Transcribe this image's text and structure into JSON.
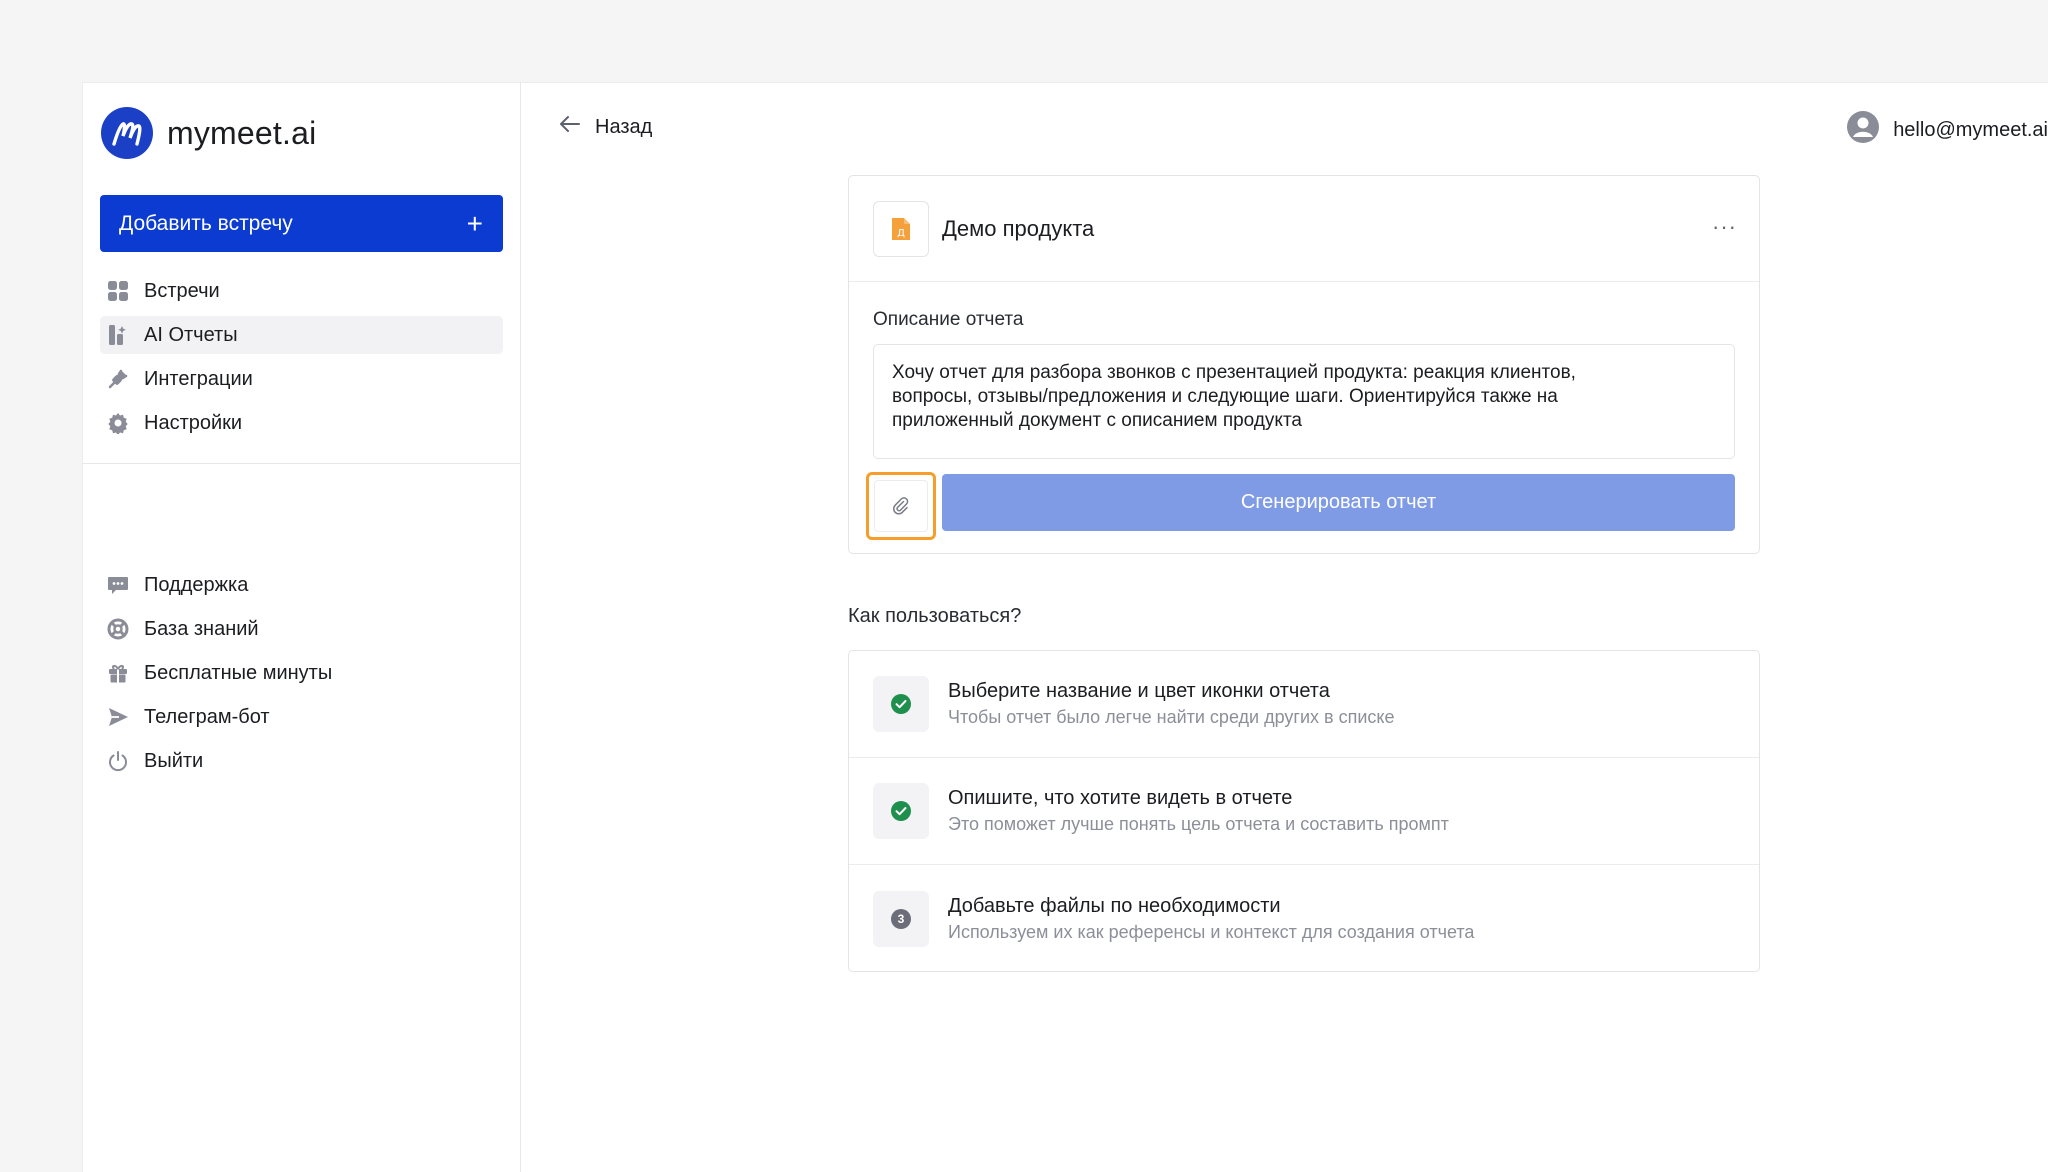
{
  "brand": {
    "name": "mymeet.ai",
    "logo_color": "#1b3fc5"
  },
  "sidebar": {
    "add_button_label": "Добавить встречу",
    "items": [
      {
        "label": "Встречи",
        "icon": "grid-icon"
      },
      {
        "label": "AI Отчеты",
        "icon": "reports-icon",
        "active": true
      },
      {
        "label": "Интеграции",
        "icon": "plug-icon"
      },
      {
        "label": "Настройки",
        "icon": "gear-icon"
      }
    ],
    "secondary_items": [
      {
        "label": "Поддержка",
        "icon": "chat-icon"
      },
      {
        "label": "База знаний",
        "icon": "lifebuoy-icon"
      },
      {
        "label": "Бесплатные минуты",
        "icon": "gift-icon"
      },
      {
        "label": "Телеграм-бот",
        "icon": "send-icon"
      },
      {
        "label": "Выйти",
        "icon": "power-icon"
      }
    ]
  },
  "header": {
    "back_label": "Назад",
    "user_email": "hello@mymeet.ai"
  },
  "report": {
    "icon_letter": "Д",
    "icon_color": "#f5a03a",
    "title": "Демо продукта",
    "description_label": "Описание отчета",
    "description_text": "Хочу отчет для разбора звонков с презентацией продукта: реакция клиентов,\nвопросы, отзывы/предложения и следующие шаги. Ориентируйся также на\nприложенный документ с описанием продукта",
    "generate_label": "Сгенерировать отчет"
  },
  "howto": {
    "label": "Как пользоваться?",
    "steps": [
      {
        "title": "Выберите название и цвет иконки отчета",
        "subtitle": "Чтобы отчет было легче найти среди других в списке",
        "status": "done"
      },
      {
        "title": "Опишите, что хотите видеть в отчете",
        "subtitle": "Это поможет лучше понять цель отчета и составить промпт",
        "status": "done"
      },
      {
        "title": "Добавьте файлы по необходимости",
        "subtitle": "Используем их как референсы и контекст для создания отчета",
        "status": "3"
      }
    ]
  },
  "colors": {
    "primary": "#0b3bd1",
    "generate_disabled": "#7f9be6",
    "attach_focus": "#f59e2b",
    "success": "#1f8f4e"
  }
}
